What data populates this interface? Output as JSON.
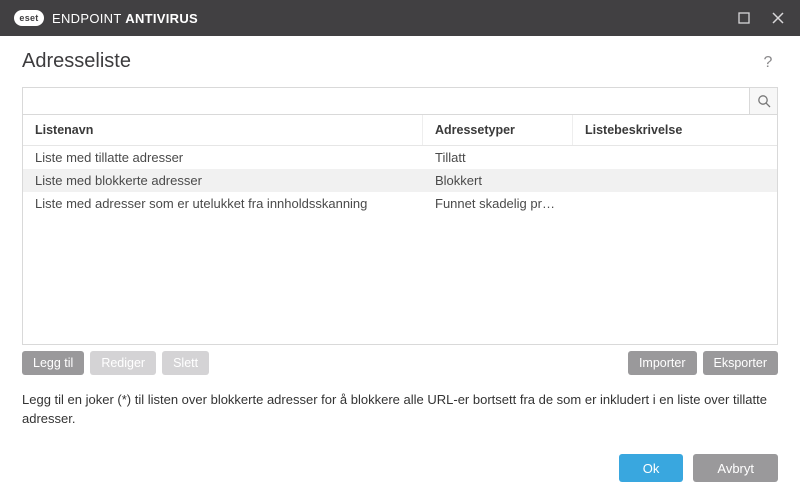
{
  "titlebar": {
    "brand_badge": "eset",
    "brand_text_light": "ENDPOINT ",
    "brand_text_bold": "ANTIVIRUS"
  },
  "page": {
    "title": "Adresseliste"
  },
  "search": {
    "placeholder": ""
  },
  "table": {
    "columns": {
      "c1": "Listenavn",
      "c2": "Adressetyper",
      "c3": "Listebeskrivelse"
    },
    "rows": [
      {
        "c1": "Liste med tillatte adresser",
        "c2": "Tillatt",
        "c3": ""
      },
      {
        "c1": "Liste med blokkerte adresser",
        "c2": "Blokkert",
        "c3": ""
      },
      {
        "c1": "Liste med adresser som er utelukket fra innholdsskanning",
        "c2": "Funnet skadelig program...",
        "c3": ""
      }
    ]
  },
  "toolbar": {
    "add": "Legg til",
    "edit": "Rediger",
    "delete": "Slett",
    "import": "Importer",
    "export": "Eksporter"
  },
  "hint": "Legg til en joker (*) til listen over blokkerte adresser for å blokkere alle URL-er bortsett fra de som er inkludert i en liste over tillatte adresser.",
  "footer": {
    "ok": "Ok",
    "cancel": "Avbryt"
  }
}
